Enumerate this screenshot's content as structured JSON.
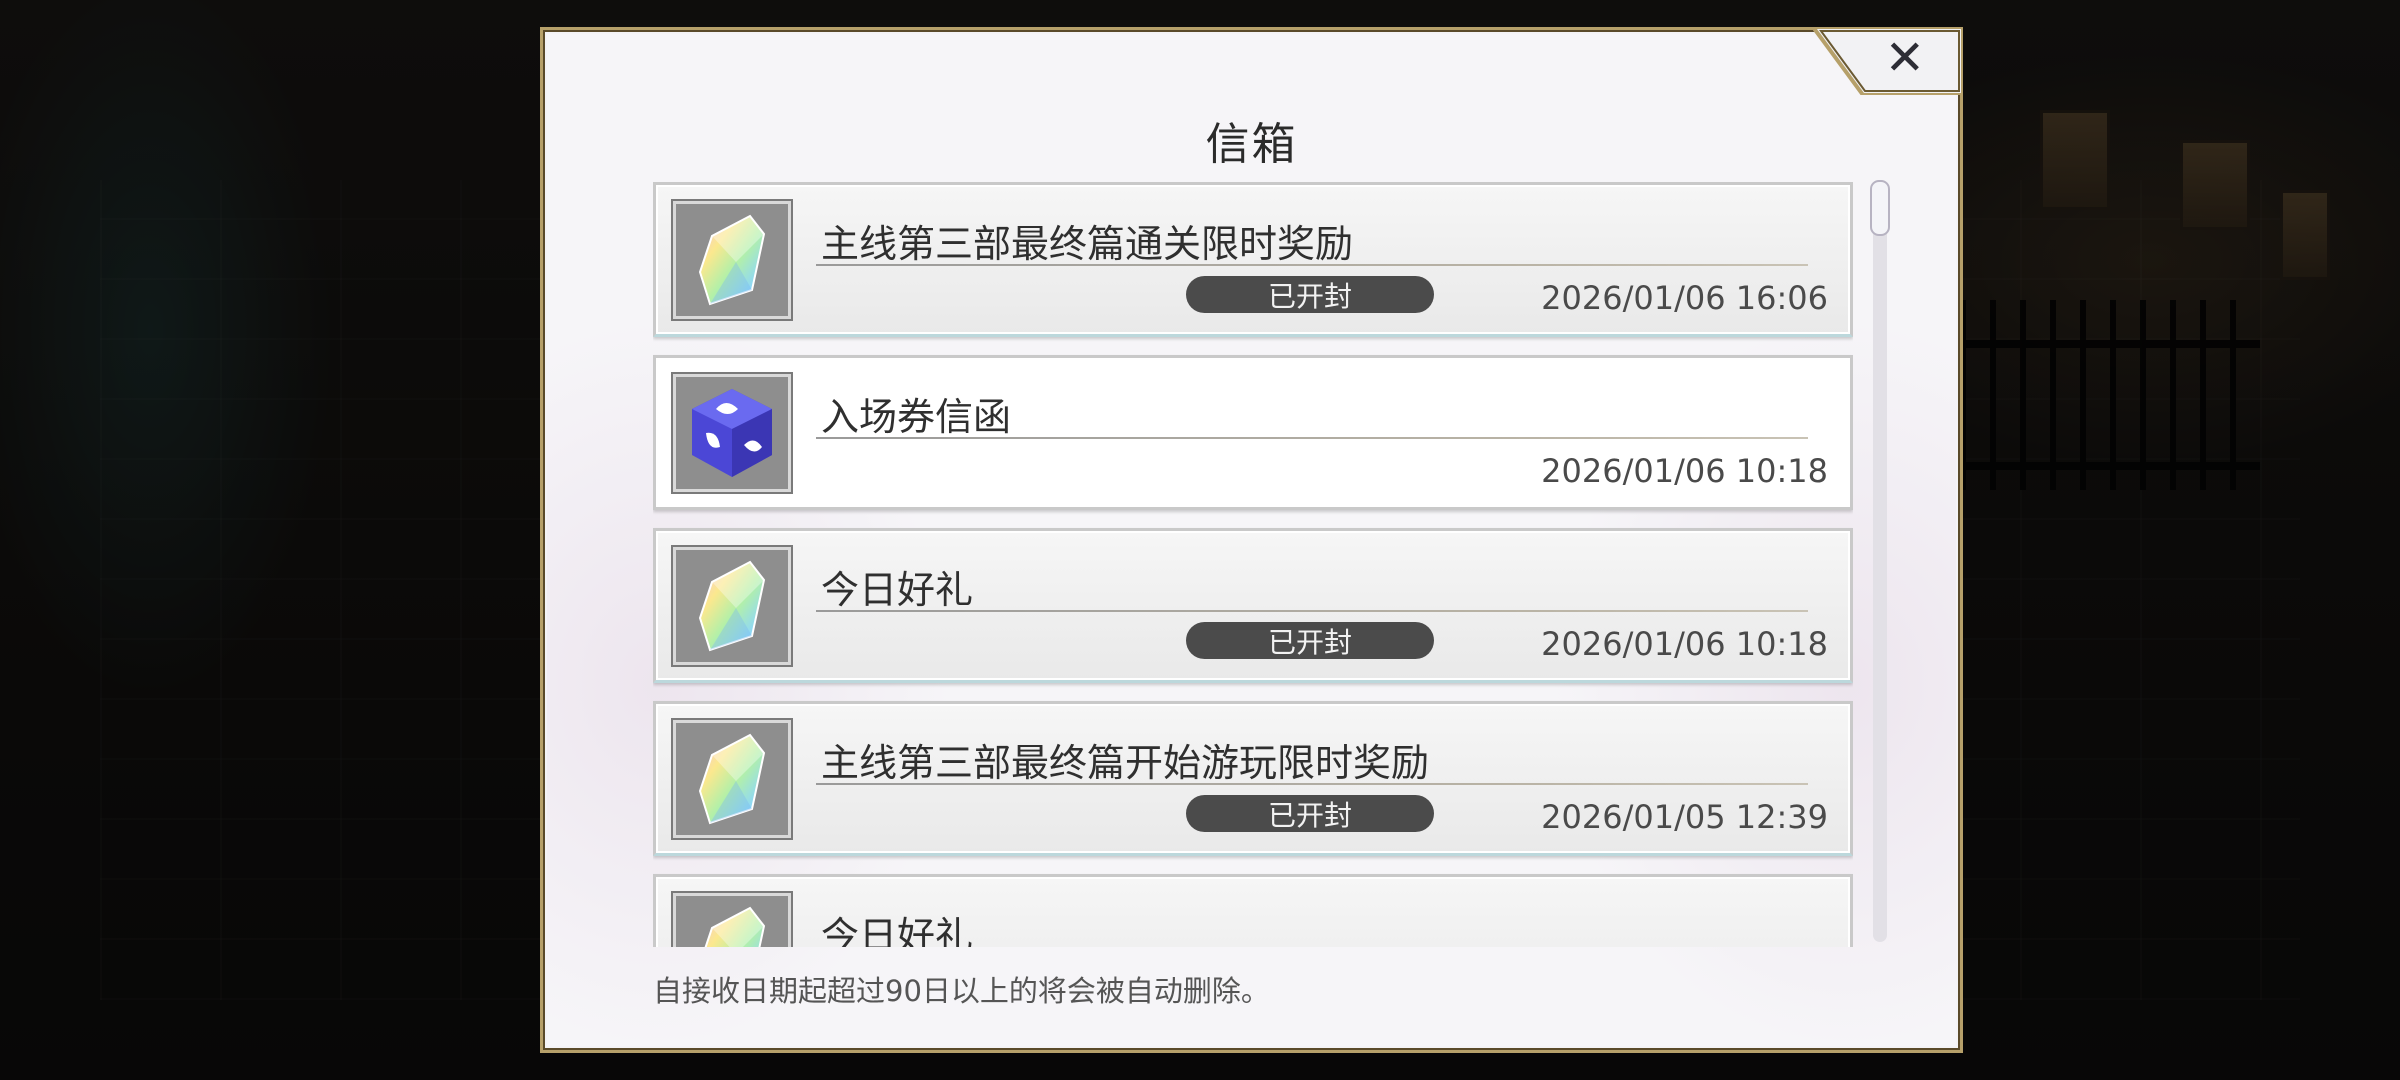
{
  "dialog": {
    "title": "信箱",
    "close_label": "✕",
    "footer_note": "自接收日期起超过90日以上的将会被自动删除。"
  },
  "mails": [
    {
      "title": "主线第三部最终篇通关限时奖励",
      "status": "已开封",
      "time": "2026/01/06 16:06",
      "icon": "rainbow-crystal-icon",
      "opened": true
    },
    {
      "title": "入场券信函",
      "status": "",
      "time": "2026/01/06 10:18",
      "icon": "ticket-cube-icon",
      "opened": false
    },
    {
      "title": "今日好礼",
      "status": "已开封",
      "time": "2026/01/06 10:18",
      "icon": "rainbow-crystal-icon",
      "opened": true
    },
    {
      "title": "主线第三部最终篇开始游玩限时奖励",
      "status": "已开封",
      "time": "2026/01/05 12:39",
      "icon": "rainbow-crystal-icon",
      "opened": true
    },
    {
      "title": "今日好礼",
      "status": "",
      "time": "",
      "icon": "rainbow-crystal-icon",
      "opened": true
    }
  ],
  "colors": {
    "frame_gold": "#b6a06a",
    "badge_bg": "#4b4b4b",
    "panel_bg": "#f6f5f8"
  }
}
